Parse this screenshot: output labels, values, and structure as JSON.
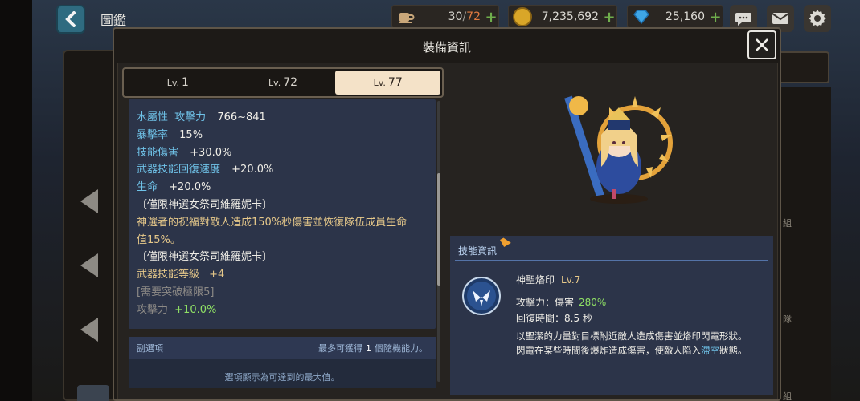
{
  "header": {
    "page_title": "圖鑑",
    "stamina": {
      "current": "30",
      "max": "72"
    },
    "gold": "7,235,692",
    "gems": "25,160",
    "icons": [
      "coffee-cup-icon",
      "gold-coin-icon",
      "diamond-icon",
      "chat-icon",
      "mail-icon",
      "gear-icon"
    ]
  },
  "dialog": {
    "title": "裝備資訊",
    "tabs": [
      {
        "prefix": "Lv.",
        "level": "1"
      },
      {
        "prefix": "Lv.",
        "level": "72"
      },
      {
        "prefix": "Lv.",
        "level": "77"
      }
    ],
    "active_tab": 2,
    "stats": {
      "line1_a": "水屬性",
      "line1_b": "攻擊力",
      "line1_c": "766~841",
      "crit_label": "暴擊率",
      "crit_value": "15%",
      "skill_dmg_label": "技能傷害",
      "skill_dmg_value": "+30.0%",
      "skill_regen_label": "武器技能回復速度",
      "skill_regen_value": "+20.0%",
      "hp_label": "生命",
      "hp_value": "+20.0%",
      "exclusive1": "〔僅限神選女祭司維羅妮卡〕",
      "exclusive1_desc_1": "神選者的祝福對敵人造成150%秒傷害並恢復隊伍成員生命",
      "exclusive1_desc_2": "值15%。",
      "exclusive2": "〔僅限神選女祭司維羅妮卡〕",
      "weapon_skill_label": "武器技能等級",
      "weapon_skill_value": "+4",
      "limit_break_note": "[需要突破極限5]",
      "atk_label": "攻擊力",
      "atk_value": "+10.0%"
    },
    "sub_options": {
      "label": "副選項",
      "max_prefix": "最多可獲得",
      "max_count": "1",
      "max_suffix": "個隨機能力。",
      "note": "選項顯示為可達到的最大值。"
    },
    "skill": {
      "header": "技能資訊",
      "name": "神聖烙印",
      "level": "Lv.7",
      "damage_label": "攻擊力：傷害",
      "damage_value": "280%",
      "cooldown": "回復時間：8.5 秒",
      "desc_line1": "以聖潔的力量對目標附近敵人造成傷害並烙印閃電形狀。",
      "desc_line2_a": "閃電在某些時間後爆炸造成傷害，使敵人陷入",
      "desc_line2_hl": "滯空",
      "desc_line2_b": "狀態。"
    }
  },
  "background": {
    "side_text_1": "組",
    "side_text_2": "隊",
    "side_text_3": "組"
  }
}
